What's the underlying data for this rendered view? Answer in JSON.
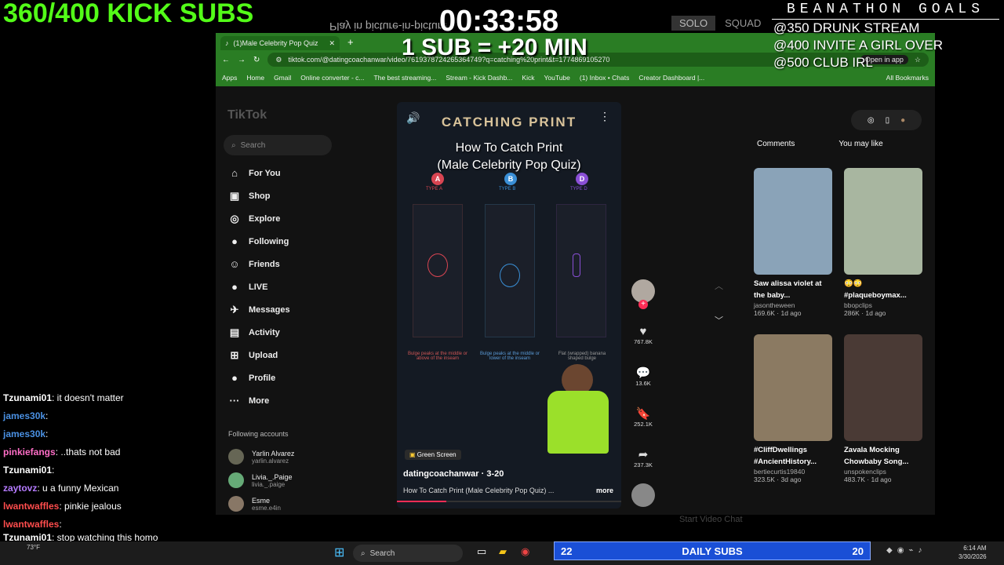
{
  "overlay": {
    "kick_subs": "360/400 KICK SUBS",
    "timer": "00:33:58",
    "sub_rule": "1 SUB = +20 MIN",
    "pip_text": "Play in picture-in-picture",
    "mode_tabs": [
      "SOLO",
      "SQUAD"
    ],
    "goals_title": "BEANATHON GOALS",
    "goals": [
      "@350 DRUNK  STREAM",
      "@400 INVITE A GIRL OVER",
      "@500 CLUB IRL"
    ]
  },
  "browser": {
    "tab_title": "(1)Male Celebrity Pop Quiz",
    "url": "tiktok.com/@datingcoachanwar/video/7619378724265364749?q=catching%20print&t=1774869105270",
    "open_in_app": "Open in app",
    "bookmarks": [
      "Apps",
      "Home",
      "Gmail",
      "Online converter - c...",
      "The best streaming...",
      "Stream - Kick Dashb...",
      "Kick",
      "YouTube",
      "(1) Inbox • Chats",
      "Creator Dashboard |..."
    ],
    "all_bookmarks": "All Bookmarks"
  },
  "tiktok": {
    "logo": "TikTok",
    "search_placeholder": "Search",
    "nav": [
      "For You",
      "Shop",
      "Explore",
      "Following",
      "Friends",
      "LIVE",
      "Messages",
      "Activity",
      "Upload",
      "Profile",
      "More"
    ],
    "following_header": "Following accounts",
    "following": [
      {
        "name": "Yarlin Alvarez",
        "handle": "yarlin.alvarez"
      },
      {
        "name": "Livia._.Paige",
        "handle": "livia._.paige"
      },
      {
        "name": "Esme",
        "handle": "esme.e4in"
      }
    ]
  },
  "video": {
    "banner": "CATCHING PRINT",
    "title_line1": "How To Catch Print",
    "title_line2": "(Male Celebrity Pop Quiz)",
    "types": [
      {
        "letter": "A",
        "label": "TYPE A",
        "color": "#d94552"
      },
      {
        "letter": "B",
        "label": "TYPE B",
        "color": "#3a8fd6"
      },
      {
        "letter": "D",
        "label": "TYPE D",
        "color": "#8a4fd6"
      }
    ],
    "captions": [
      "Bulge peaks at the middle or above of the inseam",
      "Bulge peaks at the middle or lower of the inseam",
      "Flat (wrapped) banana shaped bulge"
    ],
    "green_screen": "Green Screen",
    "author": "datingcoachanwar · 3-20",
    "caption": "How To Catch Print (Male Celebrity Pop Quiz) ...",
    "more": "more",
    "actions": {
      "likes": "767.8K",
      "comments": "13.6K",
      "saves": "252.1K",
      "shares": "237.3K"
    }
  },
  "right_panel": {
    "tabs": [
      "Comments",
      "You may like"
    ],
    "cards": [
      {
        "title": "Saw alissa violet at the baby...",
        "author": "jasontheween",
        "meta": "169.6K · 1d ago",
        "color": "#8aa3b8"
      },
      {
        "title": "😳😳 #plaqueboymax...",
        "author": "bbopclips",
        "meta": "286K · 1d ago",
        "color": "#a8b6a0"
      },
      {
        "title": "#CliffDwellings #AncientHistory...",
        "author": "bertiecurtis19840",
        "meta": "323.5K · 3d ago",
        "color": "#8b7a62"
      },
      {
        "title": "Zavala Mocking Chowbaby Song...",
        "author": "unspokenclips",
        "meta": "483.7K · 1d ago",
        "color": "#4a3a35"
      }
    ],
    "start_video_chat": "Start Video Chat"
  },
  "chat": [
    {
      "user": "Tzunami01",
      "text": ": it doesn't matter",
      "color": "#ffffff"
    },
    {
      "user": "james30k",
      "text": ":",
      "color": "#4a90e2"
    },
    {
      "user": "james30k",
      "text": ":",
      "color": "#4a90e2"
    },
    {
      "user": "pinkiefangs",
      "text": ": ..thats not bad",
      "color": "#ff6ec7"
    },
    {
      "user": "Tzunami01",
      "text": ":",
      "color": "#ffffff"
    },
    {
      "user": "zaytovz",
      "text": ": u a funny Mexican",
      "color": "#b57bff"
    },
    {
      "user": "lwantwaffles",
      "text": ": pinkie jealous",
      "color": "#ff4d4d"
    },
    {
      "user": "lwantwaffles",
      "text": ":",
      "color": "#ff4d4d"
    },
    {
      "user": "Tzunami01",
      "text": ": stop watching this homo",
      "color": "#ffffff"
    }
  ],
  "taskbar": {
    "search": "Search",
    "daily_left": "22",
    "daily_label": "DAILY SUBS",
    "daily_right": "20",
    "time": "6:14 AM",
    "date": "3/30/2026",
    "weather": "73°F"
  }
}
